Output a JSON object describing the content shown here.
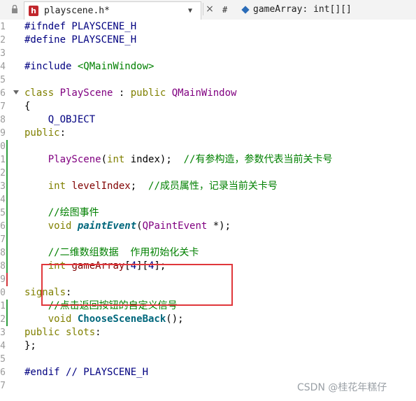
{
  "tab": {
    "title": "playscene.h*",
    "file_icon_letter": "h",
    "dropdown": "▼",
    "close": "×"
  },
  "symbol_bar": {
    "hash": "#",
    "symbol": "gameArray: int[][]"
  },
  "lines": [
    {
      "n": "1",
      "tokens": [
        {
          "t": "#ifndef PLAYSCENE_H",
          "c": "pp"
        }
      ]
    },
    {
      "n": "2",
      "tokens": [
        {
          "t": "#define PLAYSCENE_H",
          "c": "pp"
        }
      ]
    },
    {
      "n": "3",
      "tokens": []
    },
    {
      "n": "4",
      "tokens": [
        {
          "t": "#include ",
          "c": "pp"
        },
        {
          "t": "<QMainWindow>",
          "c": "inc"
        }
      ]
    },
    {
      "n": "5",
      "tokens": []
    },
    {
      "n": "6",
      "fold": true,
      "tokens": [
        {
          "t": "class ",
          "c": "kw"
        },
        {
          "t": "PlayScene",
          "c": "cls"
        },
        {
          "t": " : ",
          "c": "punc"
        },
        {
          "t": "public ",
          "c": "kw"
        },
        {
          "t": "QMainWindow",
          "c": "cls"
        }
      ]
    },
    {
      "n": "7",
      "tokens": [
        {
          "t": "{",
          "c": "punc"
        }
      ]
    },
    {
      "n": "8",
      "tokens": [
        {
          "t": "    Q_OBJECT",
          "c": "mac"
        }
      ]
    },
    {
      "n": "9",
      "tokens": [
        {
          "t": "public",
          "c": "kw"
        },
        {
          "t": ":",
          "c": "punc"
        }
      ]
    },
    {
      "n": "0",
      "marker": "#2e9e3f",
      "tokens": []
    },
    {
      "n": "1",
      "marker": "#2e9e3f",
      "tokens": [
        {
          "t": "    PlayScene",
          "c": "cls"
        },
        {
          "t": "(",
          "c": "punc"
        },
        {
          "t": "int",
          "c": "kw"
        },
        {
          "t": " index);  ",
          "c": "punc"
        },
        {
          "t": "//有参构造，参数代表当前关卡号",
          "c": "cmt"
        }
      ]
    },
    {
      "n": "2",
      "marker": "#2e9e3f",
      "tokens": []
    },
    {
      "n": "3",
      "marker": "#2e9e3f",
      "tokens": [
        {
          "t": "    int ",
          "c": "kw"
        },
        {
          "t": "levelIndex",
          "c": "var"
        },
        {
          "t": ";  ",
          "c": "punc"
        },
        {
          "t": "//成员属性，记录当前关卡号",
          "c": "cmt"
        }
      ]
    },
    {
      "n": "4",
      "marker": "#2e9e3f",
      "tokens": []
    },
    {
      "n": "5",
      "marker": "#2e9e3f",
      "tokens": [
        {
          "t": "    //绘图事件",
          "c": "cmt"
        }
      ]
    },
    {
      "n": "6",
      "marker": "#2e9e3f",
      "tokens": [
        {
          "t": "    void ",
          "c": "kw"
        },
        {
          "t": "paintEvent",
          "c": "fn"
        },
        {
          "t": "(",
          "c": "punc"
        },
        {
          "t": "QPaintEvent",
          "c": "cls"
        },
        {
          "t": " *);",
          "c": "punc"
        }
      ]
    },
    {
      "n": "7",
      "marker": "#2e9e3f",
      "tokens": []
    },
    {
      "n": "8",
      "marker": "#2e9e3f",
      "tokens": [
        {
          "t": "    //二维数组数据  作用初始化关卡",
          "c": "cmt"
        }
      ]
    },
    {
      "n": "8",
      "marker": "#2e9e3f",
      "tokens": [
        {
          "t": "    int ",
          "c": "kw"
        },
        {
          "t": "gameArray",
          "c": "var"
        },
        {
          "t": "[",
          "c": "punc"
        },
        {
          "t": "4",
          "c": "tx"
        },
        {
          "t": "][",
          "c": "punc"
        },
        {
          "t": "4",
          "c": "tx"
        },
        {
          "t": "];",
          "c": "punc"
        }
      ]
    },
    {
      "n": "9",
      "marker": "#d2353a",
      "tokens": []
    },
    {
      "n": "0",
      "tokens": [
        {
          "t": "signals",
          "c": "lab"
        },
        {
          "t": ":",
          "c": "punc"
        }
      ]
    },
    {
      "n": "1",
      "marker": "#2e9e3f",
      "tokens": [
        {
          "t": "    //点击返回按钮的自定义信号",
          "c": "cmt"
        }
      ]
    },
    {
      "n": "2",
      "marker": "#2e9e3f",
      "tokens": [
        {
          "t": "    void ",
          "c": "kw"
        },
        {
          "t": "ChooseSceneBack",
          "c": "fnb"
        },
        {
          "t": "();",
          "c": "punc"
        }
      ]
    },
    {
      "n": "3",
      "tokens": [
        {
          "t": "public slots",
          "c": "lab"
        },
        {
          "t": ":",
          "c": "punc"
        }
      ]
    },
    {
      "n": "4",
      "tokens": [
        {
          "t": "};",
          "c": "punc"
        }
      ]
    },
    {
      "n": "5",
      "tokens": []
    },
    {
      "n": "6",
      "tokens": [
        {
          "t": "#endif ",
          "c": "pp"
        },
        {
          "t": "// PLAYSCENE_H",
          "c": "mac"
        }
      ]
    },
    {
      "n": "7",
      "tokens": []
    }
  ],
  "watermark": "CSDN @桂花年糕仔"
}
